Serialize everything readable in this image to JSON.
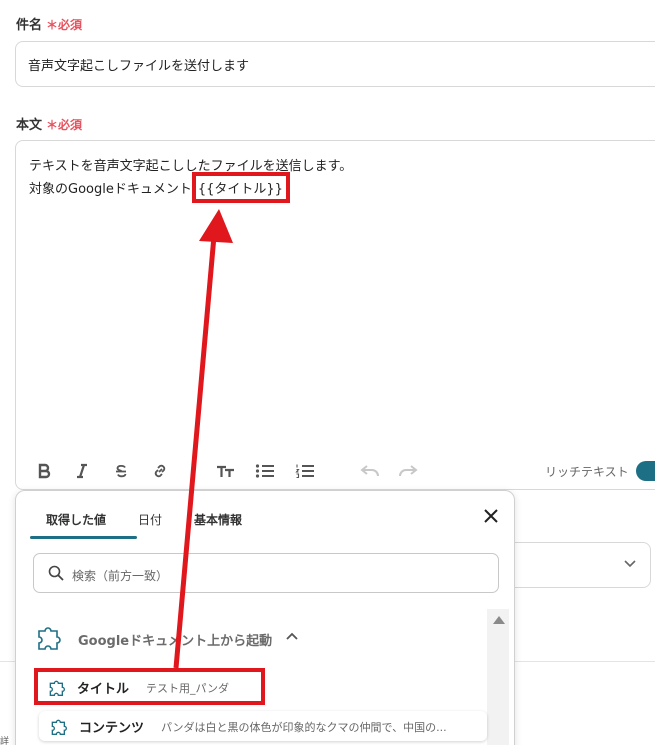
{
  "subject": {
    "label": "件名",
    "required_mark": "＊必須",
    "value": "音声文字起こしファイルを送付します"
  },
  "body": {
    "label": "本文",
    "required_mark": "＊必須",
    "line1": "テキストを音声文字起こししたファイルを送信します。",
    "line2_prefix": "対象のGoogleドキュメント",
    "variable_chip": "{{タイトル}}"
  },
  "toolbar": {
    "icons": [
      "bold-icon",
      "italic-icon",
      "strikethrough-icon",
      "link-icon",
      "text-size-icon",
      "bullet-list-icon",
      "numbered-list-icon",
      "undo-icon",
      "redo-icon"
    ],
    "rich_text_label": "リッチテキスト",
    "rich_text_enabled": true
  },
  "popup": {
    "tabs": [
      "取得した値",
      "日付",
      "基本情報"
    ],
    "active_tab": "取得した値",
    "search_placeholder": "検索（前方一致）",
    "group_label": "Googleドキュメント上から起動",
    "items": [
      {
        "name": "タイトル",
        "value": "テスト用_パンダ"
      },
      {
        "name": "コンテンツ",
        "value": "パンダは白と黒の体色が印象的なクマの仲間で、中国の..."
      }
    ]
  },
  "side_char": "詳",
  "colors": {
    "required": "#e8525e",
    "accent": "#1d6f86",
    "annotation": "#e0171c"
  }
}
